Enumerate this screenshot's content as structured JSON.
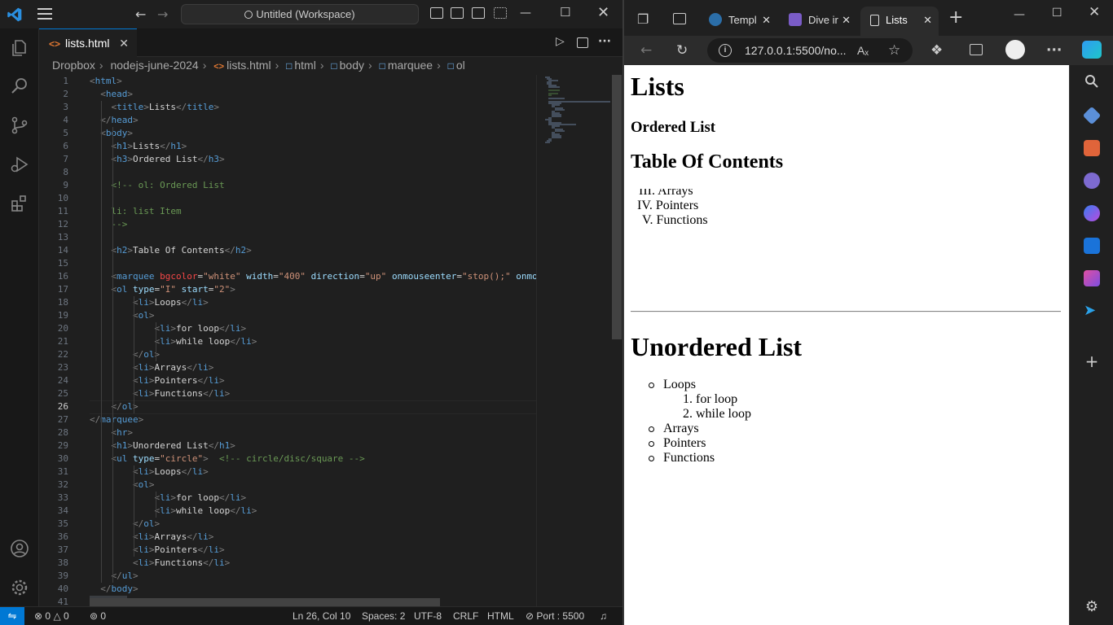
{
  "vscode": {
    "search": "Untitled (Workspace)",
    "tab": {
      "label": "lists.html"
    },
    "breadcrumb": [
      "Dropbox",
      "nodejs-june-2024",
      "lists.html",
      "html",
      "body",
      "marquee",
      "ol"
    ],
    "lines": [
      {
        "n": "1",
        "html": "<span class='tg'>&lt;</span><span class='tn'>html</span><span class='tg'>&gt;</span>"
      },
      {
        "n": "2",
        "html": "  <span class='tg'>&lt;</span><span class='tn'>head</span><span class='tg'>&gt;</span>"
      },
      {
        "n": "3",
        "html": "    <span class='tg'>&lt;</span><span class='tn'>title</span><span class='tg'>&gt;</span>Lists<span class='tg'>&lt;/</span><span class='tn'>title</span><span class='tg'>&gt;</span>"
      },
      {
        "n": "4",
        "html": "  <span class='tg'>&lt;/</span><span class='tn'>head</span><span class='tg'>&gt;</span>"
      },
      {
        "n": "5",
        "html": "  <span class='tg'>&lt;</span><span class='tn'>body</span><span class='tg'>&gt;</span>"
      },
      {
        "n": "6",
        "html": "    <span class='tg'>&lt;</span><span class='tn'>h1</span><span class='tg'>&gt;</span>Lists<span class='tg'>&lt;/</span><span class='tn'>h1</span><span class='tg'>&gt;</span>"
      },
      {
        "n": "7",
        "html": "    <span class='tg'>&lt;</span><span class='tn'>h3</span><span class='tg'>&gt;</span>Ordered List<span class='tg'>&lt;/</span><span class='tn'>h3</span><span class='tg'>&gt;</span>"
      },
      {
        "n": "8",
        "html": ""
      },
      {
        "n": "9",
        "html": "    <span class='cm'>&lt;!-- ol: Ordered List</span>"
      },
      {
        "n": "10",
        "html": ""
      },
      {
        "n": "11",
        "html": "    <span class='cm'>li: list Item</span>"
      },
      {
        "n": "12",
        "html": "    <span class='cm'>--&gt;</span>"
      },
      {
        "n": "13",
        "html": ""
      },
      {
        "n": "14",
        "html": "    <span class='tg'>&lt;</span><span class='tn'>h2</span><span class='tg'>&gt;</span>Table Of Contents<span class='tg'>&lt;/</span><span class='tn'>h2</span><span class='tg'>&gt;</span>"
      },
      {
        "n": "15",
        "html": ""
      },
      {
        "n": "16",
        "html": "    <span class='tg'>&lt;</span><span class='tn'>marquee</span> <span class='atr'>bgcolor</span>=<span class='av'>\"white\"</span> <span class='at'>width</span>=<span class='av'>\"400\"</span> <span class='at'>direction</span>=<span class='av'>\"up\"</span> <span class='at'>onmouseenter</span>=<span class='av'>\"stop();\"</span> <span class='at'>onmo</span>"
      },
      {
        "n": "17",
        "html": "    <span class='tg'>&lt;</span><span class='tn'>ol</span> <span class='at'>type</span>=<span class='av'>\"I\"</span> <span class='at'>start</span>=<span class='av'>\"2\"</span><span class='tg'>&gt;</span>"
      },
      {
        "n": "18",
        "html": "        <span class='tg'>&lt;</span><span class='tn'>li</span><span class='tg'>&gt;</span>Loops<span class='tg'>&lt;/</span><span class='tn'>li</span><span class='tg'>&gt;</span>"
      },
      {
        "n": "19",
        "html": "        <span class='tg'>&lt;</span><span class='tn'>ol</span><span class='tg'>&gt;</span>"
      },
      {
        "n": "20",
        "html": "            <span class='tg'>&lt;</span><span class='tn'>li</span><span class='tg'>&gt;</span>for loop<span class='tg'>&lt;/</span><span class='tn'>li</span><span class='tg'>&gt;</span>"
      },
      {
        "n": "21",
        "html": "            <span class='tg'>&lt;</span><span class='tn'>li</span><span class='tg'>&gt;</span>while loop<span class='tg'>&lt;/</span><span class='tn'>li</span><span class='tg'>&gt;</span>"
      },
      {
        "n": "22",
        "html": "        <span class='tg'>&lt;/</span><span class='tn'>ol</span><span class='tg'>&gt;</span>"
      },
      {
        "n": "23",
        "html": "        <span class='tg'>&lt;</span><span class='tn'>li</span><span class='tg'>&gt;</span>Arrays<span class='tg'>&lt;/</span><span class='tn'>li</span><span class='tg'>&gt;</span>"
      },
      {
        "n": "24",
        "html": "        <span class='tg'>&lt;</span><span class='tn'>li</span><span class='tg'>&gt;</span>Pointers<span class='tg'>&lt;/</span><span class='tn'>li</span><span class='tg'>&gt;</span>"
      },
      {
        "n": "25",
        "html": "        <span class='tg'>&lt;</span><span class='tn'>li</span><span class='tg'>&gt;</span>Functions<span class='tg'>&lt;/</span><span class='tn'>li</span><span class='tg'>&gt;</span>"
      },
      {
        "n": "26",
        "html": "    <span class='tg'>&lt;/</span><span class='tn'>ol</span><span class='tg'>&gt;</span>"
      },
      {
        "n": "27",
        "html": "<span class='tg'>&lt;/</span><span class='tn'>marquee</span><span class='tg'>&gt;</span>"
      },
      {
        "n": "28",
        "html": "    <span class='tg'>&lt;</span><span class='tn'>hr</span><span class='tg'>&gt;</span>"
      },
      {
        "n": "29",
        "html": "    <span class='tg'>&lt;</span><span class='tn'>h1</span><span class='tg'>&gt;</span>Unordered List<span class='tg'>&lt;/</span><span class='tn'>h1</span><span class='tg'>&gt;</span>"
      },
      {
        "n": "30",
        "html": "    <span class='tg'>&lt;</span><span class='tn'>ul</span> <span class='at'>type</span>=<span class='av'>\"circle\"</span><span class='tg'>&gt;</span>  <span class='cm'>&lt;!-- circle/disc/square --&gt;</span>"
      },
      {
        "n": "31",
        "html": "        <span class='tg'>&lt;</span><span class='tn'>li</span><span class='tg'>&gt;</span>Loops<span class='tg'>&lt;/</span><span class='tn'>li</span><span class='tg'>&gt;</span>"
      },
      {
        "n": "32",
        "html": "        <span class='tg'>&lt;</span><span class='tn'>ol</span><span class='tg'>&gt;</span>"
      },
      {
        "n": "33",
        "html": "            <span class='tg'>&lt;</span><span class='tn'>li</span><span class='tg'>&gt;</span>for loop<span class='tg'>&lt;/</span><span class='tn'>li</span><span class='tg'>&gt;</span>"
      },
      {
        "n": "34",
        "html": "            <span class='tg'>&lt;</span><span class='tn'>li</span><span class='tg'>&gt;</span>while loop<span class='tg'>&lt;/</span><span class='tn'>li</span><span class='tg'>&gt;</span>"
      },
      {
        "n": "35",
        "html": "        <span class='tg'>&lt;/</span><span class='tn'>ol</span><span class='tg'>&gt;</span>"
      },
      {
        "n": "36",
        "html": "        <span class='tg'>&lt;</span><span class='tn'>li</span><span class='tg'>&gt;</span>Arrays<span class='tg'>&lt;/</span><span class='tn'>li</span><span class='tg'>&gt;</span>"
      },
      {
        "n": "37",
        "html": "        <span class='tg'>&lt;</span><span class='tn'>li</span><span class='tg'>&gt;</span>Pointers<span class='tg'>&lt;/</span><span class='tn'>li</span><span class='tg'>&gt;</span>"
      },
      {
        "n": "38",
        "html": "        <span class='tg'>&lt;</span><span class='tn'>li</span><span class='tg'>&gt;</span>Functions<span class='tg'>&lt;/</span><span class='tn'>li</span><span class='tg'>&gt;</span>"
      },
      {
        "n": "39",
        "html": "    <span class='tg'>&lt;/</span><span class='tn'>ul</span><span class='tg'>&gt;</span>"
      },
      {
        "n": "40",
        "html": "  <span class='tg'>&lt;/</span><span class='tn'>body</span><span class='tg'>&gt;</span>"
      },
      {
        "n": "41",
        "html": "<span class='tg'>&lt;/</span><span class='tn'>html</span><span class='tg'>&gt;</span>"
      }
    ],
    "current_line": "26",
    "status": {
      "errors": "0",
      "warnings": "0",
      "ports": "0",
      "position": "Ln 26, Col 10",
      "spaces": "Spaces: 2",
      "encoding": "UTF-8",
      "eol": "CRLF",
      "language": "HTML",
      "port": "Port : 5500"
    }
  },
  "edge": {
    "tabs": [
      {
        "label": "Templ",
        "favicon_color": "#2b6ea8"
      },
      {
        "label": "Dive ir",
        "favicon_color": "#7a5cc7"
      },
      {
        "label": "Lists",
        "favicon_color": "#ffffff"
      }
    ],
    "url": "127.0.0.1:5500/no...",
    "page": {
      "h1": "Lists",
      "h3": "Ordered List",
      "h2": "Table Of Contents",
      "marquee_items": [
        {
          "marker": "III.",
          "text": "Arrays"
        },
        {
          "marker": "IV.",
          "text": "Pointers"
        },
        {
          "marker": "V.",
          "text": "Functions"
        }
      ],
      "h1_unordered": "Unordered List",
      "ul_items": [
        "Loops",
        "Arrays",
        "Pointers",
        "Functions"
      ],
      "nested": [
        {
          "marker": "1.",
          "text": "for loop"
        },
        {
          "marker": "2.",
          "text": "while loop"
        }
      ]
    }
  }
}
